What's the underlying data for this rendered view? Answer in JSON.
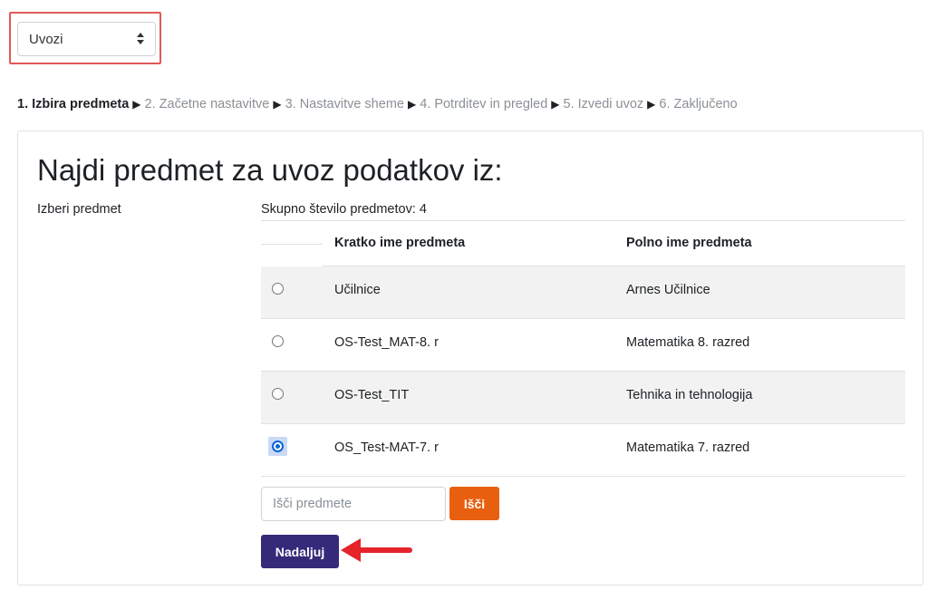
{
  "action_menu": {
    "selected": "Uvozi"
  },
  "steps": [
    {
      "label": "1. Izbira predmeta",
      "active": true
    },
    {
      "label": "2. Začetne nastavitve",
      "active": false
    },
    {
      "label": "3. Nastavitve sheme",
      "active": false
    },
    {
      "label": "4. Potrditev in pregled",
      "active": false
    },
    {
      "label": "5. Izvedi uvoz",
      "active": false
    },
    {
      "label": "6. Zaključeno",
      "active": false
    }
  ],
  "step_separator": "▶",
  "panel": {
    "title": "Najdi predmet za uvoz podatkov iz:",
    "field_label": "Izberi predmet",
    "total": "Skupno število predmetov: 4",
    "columns": {
      "short_name": "Kratko ime predmeta",
      "full_name": "Polno ime predmeta"
    },
    "courses": [
      {
        "short": "Učilnice",
        "full": "Arnes Učilnice",
        "selected": false
      },
      {
        "short": "OS-Test_MAT-8. r",
        "full": "Matematika 8. razred",
        "selected": false
      },
      {
        "short": "OS-Test_TIT",
        "full": "Tehnika in tehnologija",
        "selected": false
      },
      {
        "short": "OS_Test-MAT-7. r",
        "full": "Matematika 7. razred",
        "selected": true
      }
    ],
    "search": {
      "placeholder": "Išči predmete",
      "value": "",
      "button": "Išči"
    },
    "continue_button": "Nadaljuj"
  },
  "colors": {
    "search_button": "#e8600f",
    "continue_button": "#352a7a",
    "annotation": "#e5232a"
  }
}
